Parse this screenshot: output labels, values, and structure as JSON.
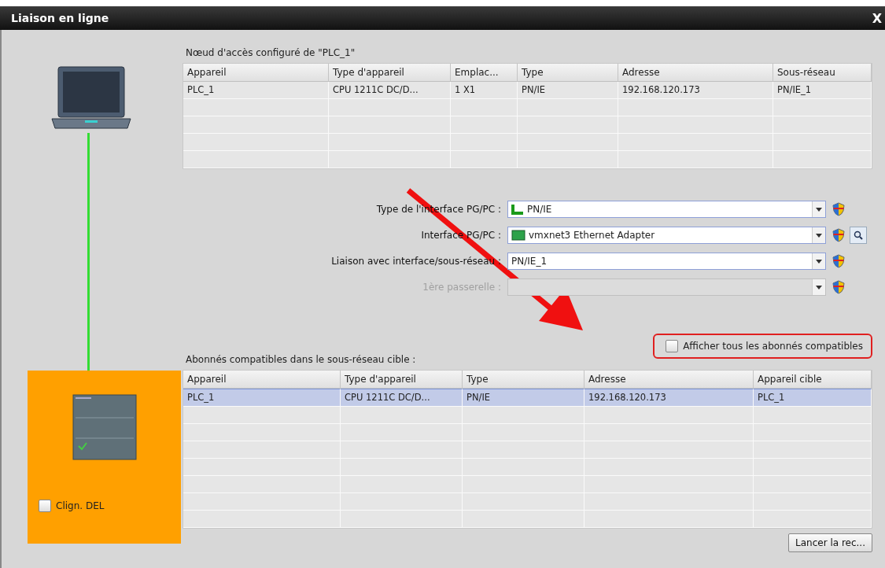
{
  "window": {
    "title": "Liaison en ligne",
    "close": "X"
  },
  "configured": {
    "caption": "Nœud d'accès configuré de \"PLC_1\"",
    "columns": [
      "Appareil",
      "Type d'appareil",
      "Emplac...",
      "Type",
      "Adresse",
      "Sous-réseau"
    ],
    "rows": [
      [
        "PLC_1",
        "CPU 1211C DC/D...",
        "1 X1",
        "PN/IE",
        "192.168.120.173",
        "PN/IE_1"
      ]
    ]
  },
  "interface": [
    {
      "label": "Type de l'interface PG/PC :",
      "value": "PN/IE",
      "kind": "network",
      "disabled": false,
      "search": false
    },
    {
      "label": "Interface PG/PC :",
      "value": "vmxnet3 Ethernet Adapter",
      "kind": "adapter",
      "disabled": false,
      "search": true
    },
    {
      "label": "Liaison avec interface/sous-réseau :",
      "value": "PN/IE_1",
      "kind": "plain",
      "disabled": false,
      "search": false
    },
    {
      "label": "1ère passerelle :",
      "kind": "plain",
      "disabled": true,
      "search": false
    }
  ],
  "show_all": {
    "label": "Afficher tous les abonnés compatibles",
    "checked": false
  },
  "compatible": {
    "caption": "Abonnés compatibles dans le sous-réseau cible :",
    "columns": [
      "Appareil",
      "Type d'appareil",
      "Type",
      "Adresse",
      "Appareil cible"
    ],
    "rows": [
      {
        "cells": [
          "PLC_1",
          "CPU 1211C DC/D...",
          "PN/IE",
          "192.168.120.173",
          "PLC_1"
        ],
        "selected": true
      }
    ]
  },
  "blink_led": {
    "label": "Clign. DEL",
    "checked": false
  },
  "start_button": "Lancer la rec..."
}
